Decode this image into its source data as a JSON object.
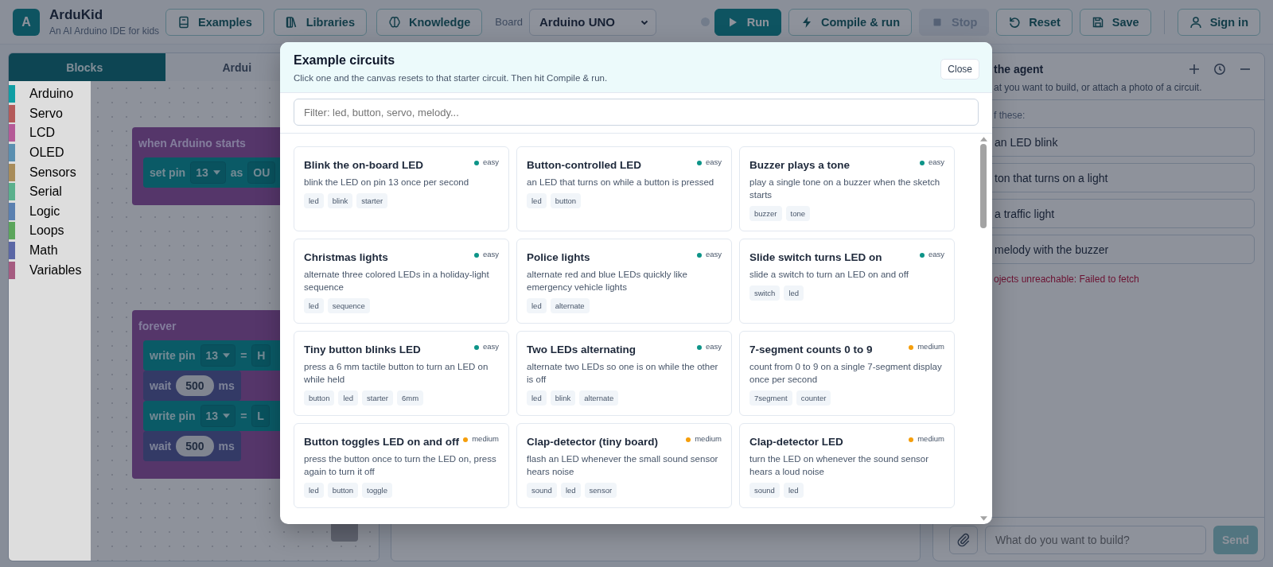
{
  "header": {
    "logo": "A",
    "title": "ArduKid",
    "subtitle": "An AI Arduino IDE for kids",
    "nav": [
      {
        "label": "Examples",
        "kind": "book"
      },
      {
        "label": "Libraries",
        "kind": "books"
      },
      {
        "label": "Knowledge",
        "kind": "brain"
      }
    ],
    "board": {
      "label": "Board",
      "value": "Arduino UNO"
    },
    "actions": [
      {
        "label": "Run",
        "kind": "play",
        "primary": true,
        "disabled": false
      },
      {
        "label": "Compile & run",
        "kind": "bolt",
        "primary": false,
        "disabled": false
      },
      {
        "label": "Stop",
        "kind": "stop",
        "primary": false,
        "disabled": true
      },
      {
        "label": "Reset",
        "kind": "reset",
        "primary": false,
        "disabled": false
      },
      {
        "label": "Save",
        "kind": "save",
        "primary": false,
        "disabled": false
      }
    ],
    "sign_in": {
      "label": "Sign in"
    }
  },
  "editor": {
    "tabs": [
      {
        "label": "Blocks",
        "selected": true
      },
      {
        "label": "Ardui",
        "selected": false
      }
    ],
    "categories": [
      {
        "label": "Arduino",
        "color": "#0f9ea4"
      },
      {
        "label": "Servo",
        "color": "#b45a5a"
      },
      {
        "label": "LCD",
        "color": "#b55a97"
      },
      {
        "label": "OLED",
        "color": "#5a8fb0"
      },
      {
        "label": "Sensors",
        "color": "#a88c5a"
      },
      {
        "label": "Serial",
        "color": "#5ab08c"
      },
      {
        "label": "Logic",
        "color": "#5a80b0"
      },
      {
        "label": "Loops",
        "color": "#5ba55b"
      },
      {
        "label": "Math",
        "color": "#5b67a5"
      },
      {
        "label": "Variables",
        "color": "#a55b80"
      }
    ],
    "blocks": [
      {
        "label": "when Arduino starts",
        "statements": [
          {
            "kind": "set_pin",
            "label": "set pin",
            "pin": "13",
            "word": "as",
            "value": "OU"
          }
        ]
      },
      {
        "label": "forever",
        "statements": [
          {
            "kind": "write_pin",
            "label": "write pin",
            "pin": "13",
            "word": "=",
            "value": "H"
          },
          {
            "kind": "wait",
            "label": "wait",
            "value": "500",
            "unit": "ms"
          },
          {
            "kind": "write_pin",
            "label": "write pin",
            "pin": "13",
            "word": "=",
            "value": "L"
          },
          {
            "kind": "wait",
            "label": "wait",
            "value": "500",
            "unit": "ms"
          }
        ]
      }
    ]
  },
  "agent": {
    "title": "the agent",
    "subtitle": "at you want to build, or attach a photo of a circuit.",
    "prompt": "f these:",
    "suggestions": [
      "an LED blink",
      "ton that turns on a light",
      "a traffic light",
      "melody with the buzzer"
    ],
    "error": "ojects unreachable: Failed to fetch",
    "input": {
      "placeholder": "What do you want to build?"
    },
    "send": {
      "label": "Send",
      "disabled": true
    }
  },
  "modal": {
    "title": "Example circuits",
    "subtitle": "Click one and the canvas resets to that starter circuit. Then hit Compile & run.",
    "close": "Close",
    "filter": {
      "placeholder": "Filter: led, button, servo, melody..."
    },
    "examples": [
      {
        "title": "Blink the on-board LED",
        "level": "easy",
        "color": "#0d9488",
        "description": "blink the LED on pin 13 once per second",
        "tags": [
          "led",
          "blink",
          "starter"
        ]
      },
      {
        "title": "Button-controlled LED",
        "level": "easy",
        "color": "#0d9488",
        "description": "an LED that turns on while a button is pressed",
        "tags": [
          "led",
          "button"
        ]
      },
      {
        "title": "Buzzer plays a tone",
        "level": "easy",
        "color": "#0d9488",
        "description": "play a single tone on a buzzer when the sketch starts",
        "tags": [
          "buzzer",
          "tone"
        ]
      },
      {
        "title": "Christmas lights",
        "level": "easy",
        "color": "#0d9488",
        "description": "alternate three colored LEDs in a holiday-light sequence",
        "tags": [
          "led",
          "sequence"
        ]
      },
      {
        "title": "Police lights",
        "level": "easy",
        "color": "#0d9488",
        "description": "alternate red and blue LEDs quickly like emergency vehicle lights",
        "tags": [
          "led",
          "alternate"
        ]
      },
      {
        "title": "Slide switch turns LED on",
        "level": "easy",
        "color": "#0d9488",
        "description": "slide a switch to turn an LED on and off",
        "tags": [
          "switch",
          "led"
        ]
      },
      {
        "title": "Tiny button blinks LED",
        "level": "easy",
        "color": "#0d9488",
        "description": "press a 6 mm tactile button to turn an LED on while held",
        "tags": [
          "button",
          "led",
          "starter",
          "6mm"
        ]
      },
      {
        "title": "Two LEDs alternating",
        "level": "easy",
        "color": "#0d9488",
        "description": "alternate two LEDs so one is on while the other is off",
        "tags": [
          "led",
          "blink",
          "alternate"
        ]
      },
      {
        "title": "7-segment counts 0 to 9",
        "level": "medium",
        "color": "#f59e0b",
        "description": "count from 0 to 9 on a single 7-segment display once per second",
        "tags": [
          "7segment",
          "counter"
        ]
      },
      {
        "title": "Button toggles LED on and off",
        "level": "medium",
        "color": "#f59e0b",
        "description": "press the button once to turn the LED on, press again to turn it off",
        "tags": [
          "led",
          "button",
          "toggle"
        ]
      },
      {
        "title": "Clap-detector (tiny board)",
        "level": "medium",
        "color": "#f59e0b",
        "description": "flash an LED whenever the small sound sensor hears noise",
        "tags": [
          "sound",
          "led",
          "sensor"
        ]
      },
      {
        "title": "Clap-detector LED",
        "level": "medium",
        "color": "#f59e0b",
        "description": "turn the LED on whenever the sound sensor hears a loud noise",
        "tags": [
          "sound",
          "led"
        ]
      }
    ]
  }
}
